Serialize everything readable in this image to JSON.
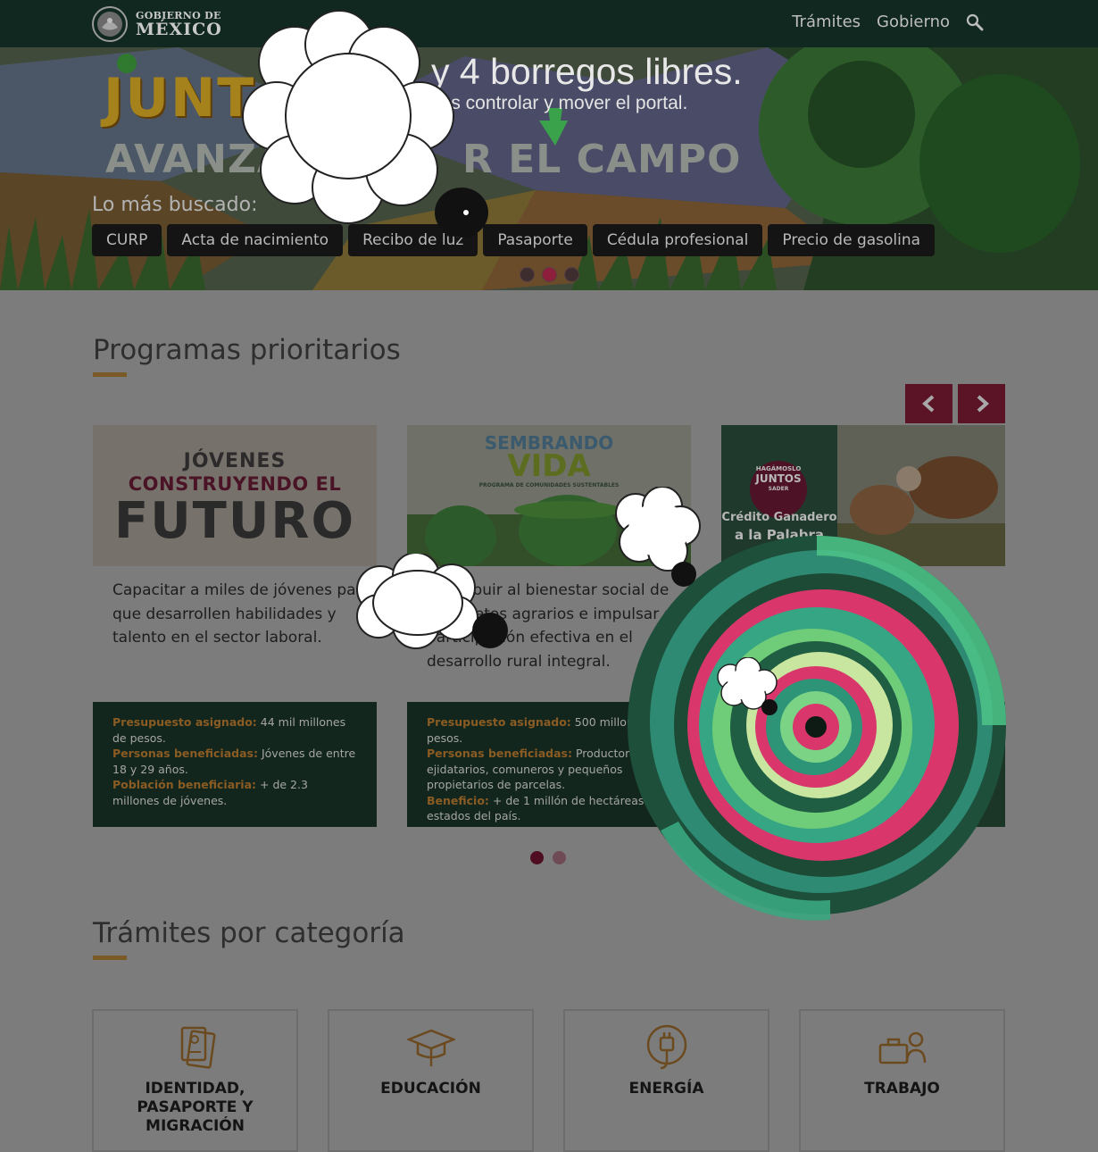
{
  "nav": {
    "logo_line1": "GOBIERNO DE",
    "logo_line2": "MÉXICO",
    "links": [
      "Trámites",
      "Gobierno"
    ],
    "search_icon": "search-icon"
  },
  "hero": {
    "word_junt": "JUNT",
    "word_avanza": "AVANZA",
    "word_campo": "R EL CAMPO",
    "overlay_title": "y 4 borregos libres.",
    "overlay_sub": "les controlar y mover el portal.",
    "most_searched_label": "Lo más buscado:",
    "chips": [
      "CURP",
      "Acta de nacimiento",
      "Recibo de luz",
      "Pasaporte",
      "Cédula profesional",
      "Precio de gasolina"
    ],
    "carousel_dots": 3,
    "active_dot": 1
  },
  "programs": {
    "title": "Programas prioritarios",
    "cards": [
      {
        "img_lines": [
          "JÓVENES",
          "CONSTRUYENDO EL",
          "FUTURO"
        ],
        "description": "Capacitar a miles de jóvenes para que desarrollen habilidades y talento en el sector laboral.",
        "info": [
          {
            "k": "Presupuesto asignado:",
            "v": "44 mil millones de pesos."
          },
          {
            "k": "Personas beneficiadas:",
            "v": "Jóvenes de entre 18 y 29 años."
          },
          {
            "k": "Población beneficiaria:",
            "v": "+ de 2.3 millones de jóvenes."
          }
        ]
      },
      {
        "img_lines": [
          "SEMBRANDO",
          "VIDA",
          "PROGRAMA DE COMUNIDADES SUSTENTABLES"
        ],
        "description": "Contribuir al bienestar social de los sujetos agrarios e impulsar su participación efectiva en el desarrollo rural integral.",
        "info": [
          {
            "k": "Presupuesto asignado:",
            "v": "500 millones de pesos."
          },
          {
            "k": "Personas beneficiadas:",
            "v": "Productores, ejidatarios, comuneros y pequeños propietarios de parcelas."
          },
          {
            "k": "Beneficio:",
            "v": "+ de 1 millón de hectáreas en estados del país."
          }
        ]
      },
      {
        "img_lines": [
          "HAGÁMOSLO",
          "JUNTOS",
          "SADER",
          "Crédito Ganadero",
          "a la Palabra"
        ]
      }
    ],
    "carousel_dots": 2,
    "active_dot": 0
  },
  "categories": {
    "title": "Trámites por categoría",
    "items": [
      {
        "label": "IDENTIDAD, PASAPORTE Y MIGRACIÓN",
        "icon": "id-document-icon"
      },
      {
        "label": "EDUCACIÓN",
        "icon": "graduation-cap-icon"
      },
      {
        "label": "ENERGÍA",
        "icon": "energy-plug-icon"
      },
      {
        "label": "TRABAJO",
        "icon": "briefcase-worker-icon"
      }
    ]
  },
  "colors": {
    "nav_bg": "#10281f",
    "accent_red": "#5b1426",
    "gold": "#7a5a26",
    "info_bg": "#13261d"
  }
}
